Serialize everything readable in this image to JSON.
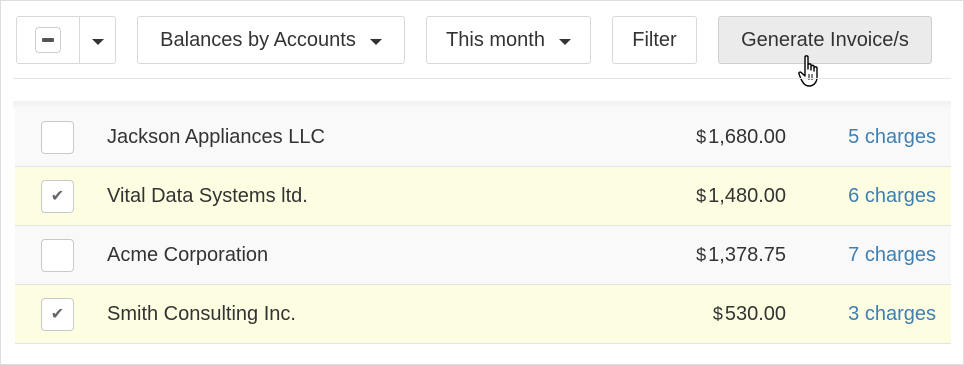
{
  "toolbar": {
    "balances_label": "Balances by Accounts",
    "month_label": "This month",
    "filter_label": "Filter",
    "generate_label": "Generate Invoice/s"
  },
  "accounts": [
    {
      "name": "Jackson Appliances LLC",
      "currency": "$",
      "amount": "1,680.00",
      "charges": "5 charges",
      "checked": false
    },
    {
      "name": "Vital Data Systems ltd.",
      "currency": "$",
      "amount": "1,480.00",
      "charges": "6 charges",
      "checked": true
    },
    {
      "name": "Acme Corporation",
      "currency": "$",
      "amount": "1,378.75",
      "charges": "7 charges",
      "checked": false
    },
    {
      "name": "Smith Consulting Inc.",
      "currency": "$",
      "amount": "530.00",
      "charges": "3 charges",
      "checked": true
    }
  ],
  "colors": {
    "selected_row": "#fdfde1",
    "link": "#3f7fb2"
  },
  "icons": {
    "select_all": "indeterminate-checkbox-icon",
    "caret": "caret-down-icon",
    "check": "check-mark-icon",
    "cursor": "hand-pointer-icon"
  }
}
